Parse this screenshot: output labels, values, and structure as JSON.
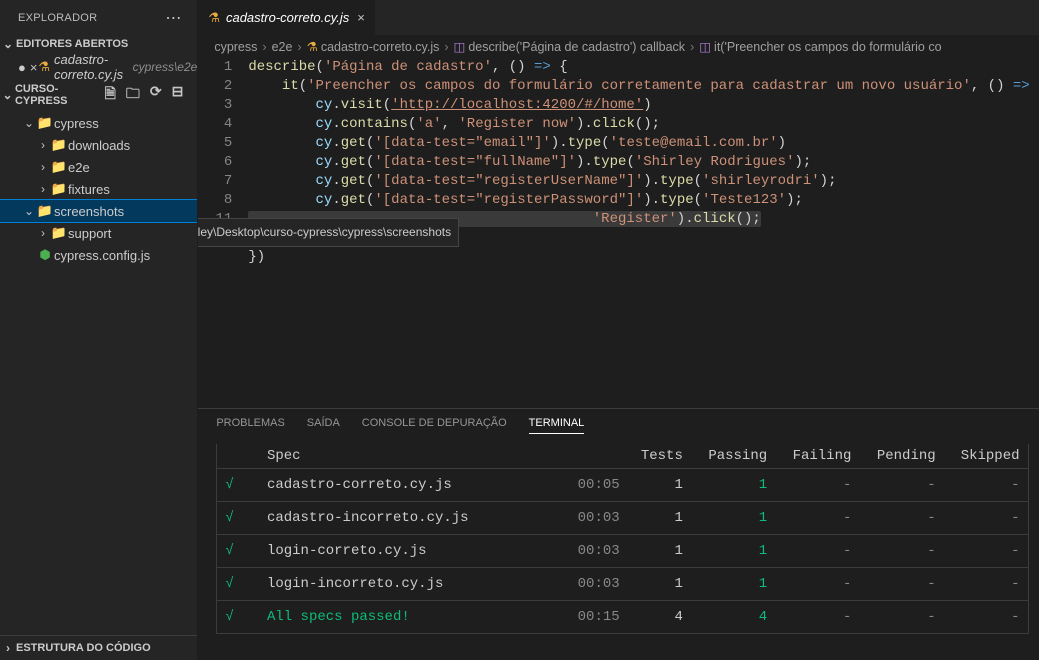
{
  "sidebar": {
    "title": "Explorador",
    "more": "...",
    "openEditors": {
      "label": "Editores Abertos",
      "items": [
        {
          "name": "cadastro-correto.cy.js",
          "path": "cypress\\e2e",
          "modified": true
        }
      ]
    },
    "project": {
      "name": "CURSO-CYPRESS",
      "toolbarIcons": [
        "new-file",
        "new-folder",
        "refresh",
        "collapse"
      ]
    },
    "tree": [
      {
        "indent": 1,
        "chev": "v",
        "icon": "📁",
        "iconColor": "#21a179",
        "label": "cypress"
      },
      {
        "indent": 2,
        "chev": ">",
        "icon": "📁",
        "iconColor": "#21a179",
        "label": "downloads"
      },
      {
        "indent": 2,
        "chev": ">",
        "icon": "📁",
        "iconColor": "#21a179",
        "label": "e2e"
      },
      {
        "indent": 2,
        "chev": ">",
        "icon": "📁",
        "iconColor": "#8e6e53",
        "label": "fixtures"
      },
      {
        "indent": 1,
        "chev": "v",
        "icon": "📁",
        "iconColor": "#21a179",
        "label": "screenshots",
        "selected": true
      },
      {
        "indent": 2,
        "chev": ">",
        "icon": "📁",
        "iconColor": "#90a4ae",
        "label": "support"
      },
      {
        "indent": 1,
        "chev": "",
        "icon": "⬢",
        "iconColor": "#4caf50",
        "label": "cypress.config.js"
      }
    ],
    "outline": "Estrutura do Código"
  },
  "tab": {
    "name": "cadastro-correto.cy.js"
  },
  "breadcrumbs": {
    "parts": [
      "cypress",
      "e2e",
      "cadastro-correto.cy.js",
      "describe('Página de cadastro') callback",
      "it('Preencher os campos do formulário co"
    ]
  },
  "tooltip": "C:\\Users\\Shirley\\Desktop\\curso-cypress\\cypress\\screenshots",
  "code": {
    "lines": [
      "describe('Página de cadastro', () => {",
      "    it('Preencher os campos do formulário corretamente para cadastrar um novo usuário', () => {",
      "        cy.visit('http://localhost:4200/#/home')",
      "        cy.contains('a', 'Register now').click();",
      "        cy.get('[data-test=\"email\"]').type('teste@email.com.br')",
      "        cy.get('[data-test=\"fullName\"]').type('Shirley Rodrigues');",
      "        cy.get('[data-test=\"registerUserName\"]').type('shirleyrodri');",
      "        cy.get('[data-test=\"registerPassword\"]').type('Teste123');",
      "                                         'Register').click();",
      "    })",
      "})"
    ],
    "numbers": [
      "1",
      "2",
      "3",
      "4",
      "5",
      "6",
      "7",
      "8",
      "",
      "",
      "11"
    ]
  },
  "panel": {
    "tabs": {
      "problems": "Problemas",
      "output": "Saída",
      "debug": "Console de Depuração",
      "terminal": "Terminal"
    },
    "headers": {
      "spec": "Spec",
      "tests": "Tests",
      "passing": "Passing",
      "failing": "Failing",
      "pending": "Pending",
      "skipped": "Skipped"
    },
    "rows": [
      {
        "spec": "cadastro-correto.cy.js",
        "time": "00:05",
        "tests": "1",
        "passing": "1",
        "failing": "-",
        "pending": "-",
        "skipped": "-"
      },
      {
        "spec": "cadastro-incorreto.cy.js",
        "time": "00:03",
        "tests": "1",
        "passing": "1",
        "failing": "-",
        "pending": "-",
        "skipped": "-"
      },
      {
        "spec": "login-correto.cy.js",
        "time": "00:03",
        "tests": "1",
        "passing": "1",
        "failing": "-",
        "pending": "-",
        "skipped": "-"
      },
      {
        "spec": "login-incorreto.cy.js",
        "time": "00:03",
        "tests": "1",
        "passing": "1",
        "failing": "-",
        "pending": "-",
        "skipped": "-"
      }
    ],
    "summary": {
      "label": "All specs passed!",
      "time": "00:15",
      "tests": "4",
      "passing": "4",
      "failing": "-",
      "pending": "-",
      "skipped": "-"
    }
  }
}
